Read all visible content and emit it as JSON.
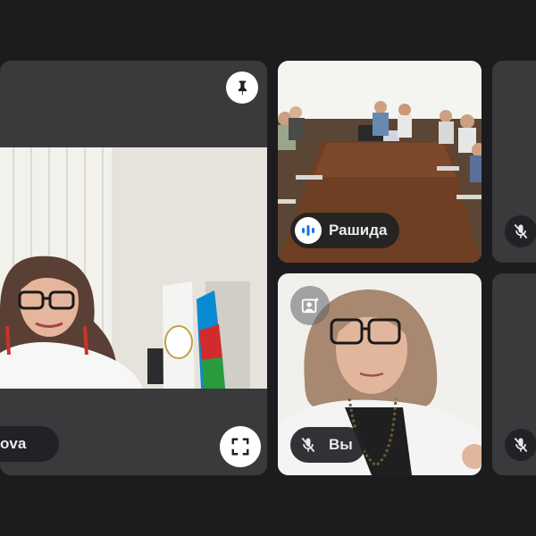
{
  "participants": {
    "main_speaker": {
      "name_partial": "ova"
    },
    "top_right": {
      "name": "Рашида"
    },
    "self": {
      "name": "Вы"
    }
  },
  "icons": {
    "pin": "pin-icon",
    "fullscreen": "fullscreen-icon",
    "speaking": "speaking-indicator-icon",
    "mic_off": "mic-off-icon",
    "add_effects": "portrait-effects-icon"
  },
  "colors": {
    "background": "#1c1c1e",
    "tile": "#3a3a3d",
    "speaking_accent": "#8ab4f8",
    "pill_bg": "#202124"
  }
}
